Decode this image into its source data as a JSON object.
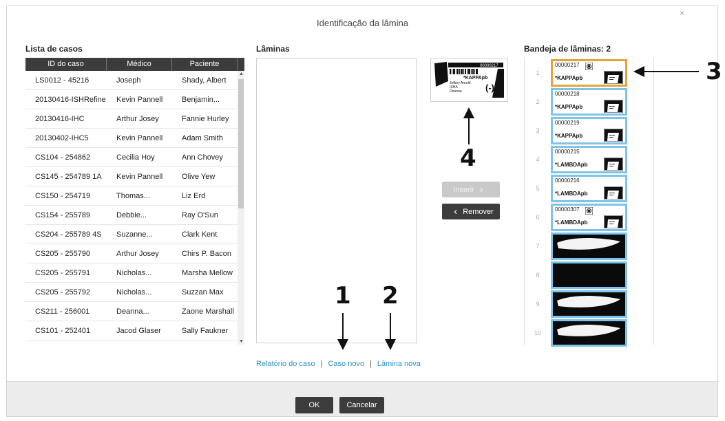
{
  "dialog": {
    "title": "Identificação da lâmina",
    "close_glyph": "×"
  },
  "case_list": {
    "label": "Lista de casos",
    "columns": [
      "ID do caso",
      "Médico",
      "Paciente"
    ],
    "rows": [
      [
        "LS0012 - 45216",
        "Joseph",
        "Shady, Albert"
      ],
      [
        "20130416-ISHRefine",
        "Kevin Pannell",
        "Benjamin..."
      ],
      [
        "20130416-IHC",
        "Arthur Josey",
        "Fannie Hurley"
      ],
      [
        "20130402-IHC5",
        "Kevin Pannell",
        "Adam Smith"
      ],
      [
        "CS104 - 254862",
        "Cecilia Hoy",
        "Ann Chovey"
      ],
      [
        "CS145 - 254789 1A",
        "Kevin Pannell",
        "Olive Yew"
      ],
      [
        "CS150 - 254719",
        "Thomas...",
        "Liz Erd"
      ],
      [
        "CS154 - 255789",
        "Debbie...",
        "Ray O'Sun"
      ],
      [
        "CS204 - 255789 4S",
        "Suzanne...",
        "Clark Kent"
      ],
      [
        "CS205 - 255790",
        "Arthur Josey",
        "Chirs P. Bacon"
      ],
      [
        "CS205 - 255791",
        "Nicholas...",
        "Marsha Mellow"
      ],
      [
        "CS205 - 255792",
        "Nicholas...",
        "Suzzan Max"
      ],
      [
        "CS211 - 256001",
        "Deanna...",
        "Zaone Marshall"
      ],
      [
        "CS101 - 252401",
        "Jacod Glaser",
        "Sally Faukner"
      ]
    ]
  },
  "slides": {
    "label": "Lâminas"
  },
  "label_preview": {
    "code": "00000217",
    "stain": "*KAPPApb",
    "name1": "Jeffrey Arnold",
    "name2": "ISHA",
    "name3": "Deanna",
    "mark": "(-)"
  },
  "buttons": {
    "insert": "Inserir",
    "remove": "Remover",
    "ok": "OK",
    "cancel": "Cancelar"
  },
  "links": {
    "case_report": "Relatório do caso",
    "new_case": "Caso novo",
    "new_slide": "Lâmina nova",
    "separator": "|"
  },
  "tray": {
    "label": "Bandeja de lâminas: 2",
    "slots": [
      {
        "num": "1",
        "id": "00000217",
        "stain": "*KAPPApb",
        "selected": true
      },
      {
        "num": "2",
        "id": "00000218",
        "stain": "*KAPPApb"
      },
      {
        "num": "3",
        "id": "00000219",
        "stain": "*KAPPApb"
      },
      {
        "num": "4",
        "id": "00000215",
        "stain": "*LAMBDApb"
      },
      {
        "num": "5",
        "id": "00000216",
        "stain": "*LAMBDApb"
      },
      {
        "num": "6",
        "id": "00000307",
        "stain": "*LAMBDApb"
      },
      {
        "num": "7"
      },
      {
        "num": "8"
      },
      {
        "num": "9"
      },
      {
        "num": "10"
      }
    ]
  },
  "callouts": [
    "1",
    "2",
    "3",
    "4"
  ],
  "colors": {
    "accent": "#7dc3ea",
    "selected": "#e3a33b",
    "link": "#2c8fc7",
    "dark_button": "#3c3c3c"
  }
}
